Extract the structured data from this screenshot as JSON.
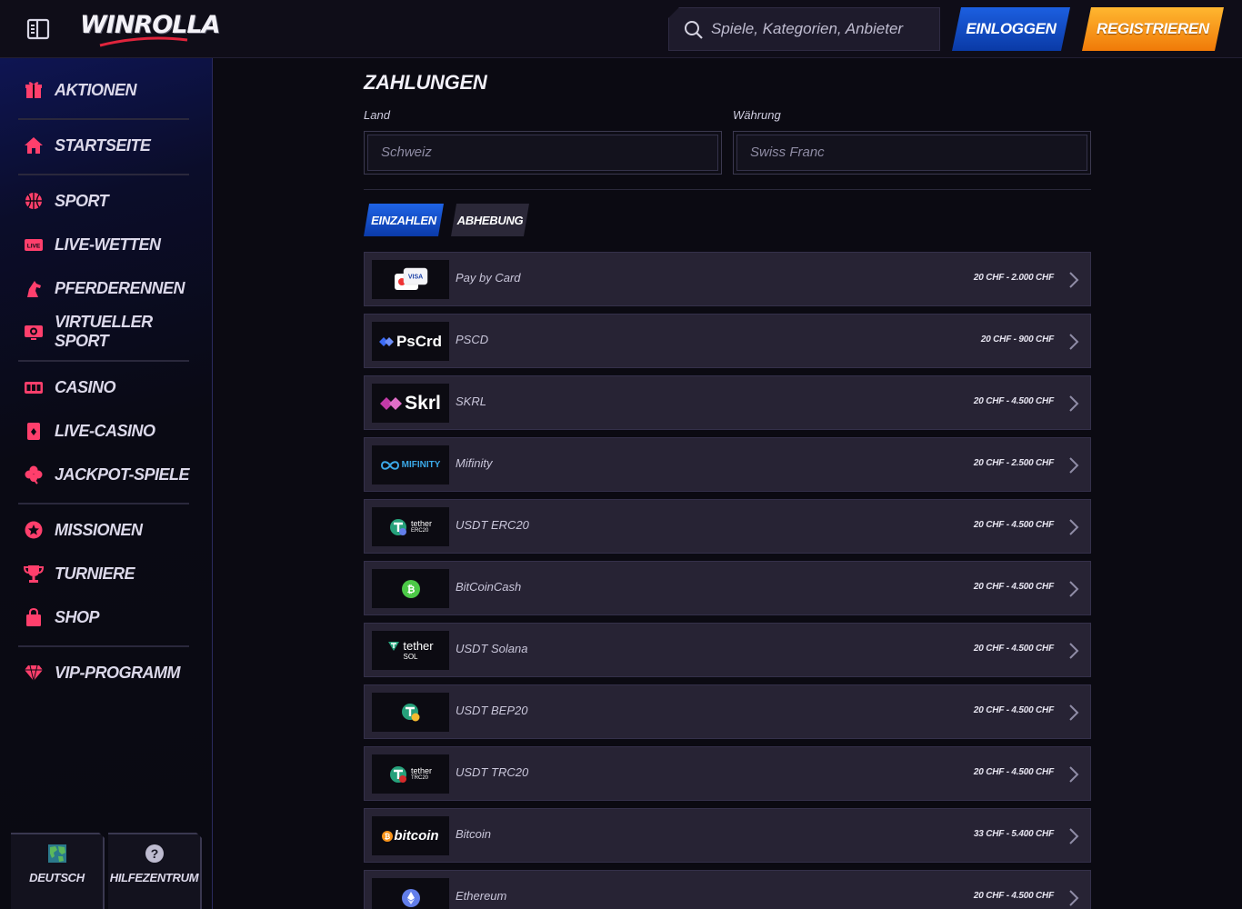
{
  "header": {
    "logo_text": "WINROLLA",
    "search_placeholder": "Spiele, Kategorien, Anbieter",
    "login_label": "EINLOGGEN",
    "register_label": "REGISTRIEREN"
  },
  "sidebar": {
    "items": [
      {
        "label": "AKTIONEN",
        "icon": "gift-icon"
      },
      {
        "label": "STARTSEITE",
        "icon": "home-icon"
      },
      {
        "label": "SPORT",
        "icon": "basketball-icon"
      },
      {
        "label": "LIVE-WETTEN",
        "icon": "live-icon"
      },
      {
        "label": "PFERDERENNEN",
        "icon": "horse-icon"
      },
      {
        "label": "VIRTUELLER SPORT",
        "icon": "virtual-sport-icon"
      },
      {
        "label": "CASINO",
        "icon": "slot-machine-icon"
      },
      {
        "label": "LIVE-CASINO",
        "icon": "cards-icon"
      },
      {
        "label": "JACKPOT-SPIELE",
        "icon": "clover-icon"
      },
      {
        "label": "MISSIONEN",
        "icon": "star-badge-icon"
      },
      {
        "label": "TURNIERE",
        "icon": "trophy-icon"
      },
      {
        "label": "SHOP",
        "icon": "shopping-bag-icon"
      },
      {
        "label": "VIP-PROGRAMM",
        "icon": "diamond-icon"
      }
    ],
    "language_label": "DEUTSCH",
    "help_label": "HILFEZENTRUM",
    "live_badge": "LIVE"
  },
  "main": {
    "title": "ZAHLUNGEN",
    "country_label": "Land",
    "country_value": "Schweiz",
    "currency_label": "Währung",
    "currency_value": "Swiss Franc",
    "tabs": [
      {
        "label": "EINZAHLEN",
        "active": true
      },
      {
        "label": "ABHEBUNG",
        "active": false
      }
    ],
    "methods": [
      {
        "name": "Pay by Card",
        "range": "20 CHF - 2.000 CHF",
        "logo_text": "VISA"
      },
      {
        "name": "PSCD",
        "range": "20 CHF - 900 CHF",
        "logo_text": "PsCrd"
      },
      {
        "name": "SKRL",
        "range": "20 CHF - 4.500 CHF",
        "logo_text": "Skrl"
      },
      {
        "name": "Mifinity",
        "range": "20 CHF - 2.500 CHF",
        "logo_text": "MIFINITY"
      },
      {
        "name": "USDT ERC20",
        "range": "20 CHF - 4.500 CHF",
        "logo_text": "tether",
        "logo_sub": "ERC20"
      },
      {
        "name": "BitCoinCash",
        "range": "20 CHF - 4.500 CHF",
        "logo_text": ""
      },
      {
        "name": "USDT Solana",
        "range": "20 CHF - 4.500 CHF",
        "logo_text": "tether",
        "logo_sub": "SOL"
      },
      {
        "name": "USDT BEP20",
        "range": "20 CHF - 4.500 CHF",
        "logo_text": ""
      },
      {
        "name": "USDT TRC20",
        "range": "20 CHF - 4.500 CHF",
        "logo_text": "tether",
        "logo_sub": "TRC20"
      },
      {
        "name": "Bitcoin",
        "range": "33 CHF - 5.400 CHF",
        "logo_text": "bitcoin"
      },
      {
        "name": "Ethereum",
        "range": "20 CHF - 4.500 CHF",
        "logo_text": ""
      }
    ]
  },
  "colors": {
    "accent_pink": "#ff3f6c",
    "login_blue": "#1c5fe0",
    "register_orange": "#ffb730",
    "row_bg": "#272334"
  }
}
